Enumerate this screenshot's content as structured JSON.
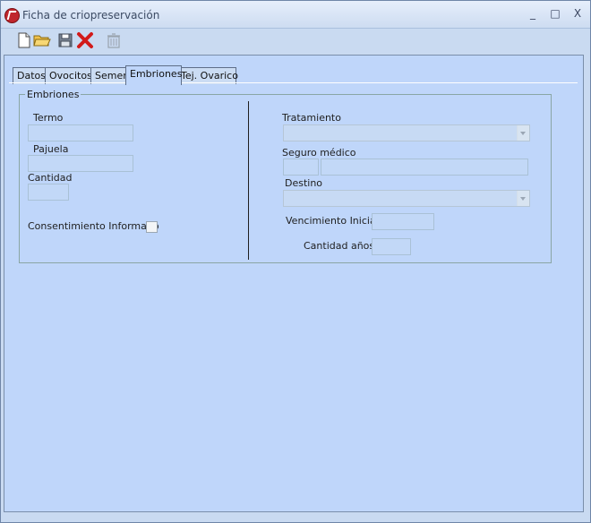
{
  "window": {
    "title": "Ficha de criopreservación",
    "controls": {
      "minimize": "_",
      "maximize": "□",
      "close": "X"
    }
  },
  "toolbar": {
    "items": [
      {
        "icon": "new-document-icon"
      },
      {
        "icon": "open-folder-icon"
      },
      {
        "icon": "save-icon"
      },
      {
        "icon": "delete-x-icon"
      },
      {
        "icon": "trash-icon",
        "disabled": true
      }
    ]
  },
  "tabs": {
    "items": [
      "Datos",
      "Ovocitos",
      "Semen",
      "Embriones",
      "Tej. Ovarico"
    ],
    "active": "Embriones"
  },
  "form": {
    "group_title": "Embriones",
    "termo_label": "Termo",
    "termo_value": "",
    "pajuela_label": "Pajuela",
    "pajuela_value": "",
    "cantidad_label": "Cantidad",
    "cantidad_value": "",
    "consentimiento_label": "Consentimiento Informado",
    "consentimiento_checked": false,
    "tratamiento_label": "Tratamiento",
    "tratamiento_value": "",
    "seguro_label": "Seguro médico",
    "seguro_code": "",
    "seguro_name": "",
    "destino_label": "Destino",
    "destino_value": "",
    "vencimiento_label": "Vencimiento Inicial",
    "vencimiento_value": "",
    "cantidad_anos_label": "Cantidad años",
    "cantidad_anos_value": ""
  }
}
